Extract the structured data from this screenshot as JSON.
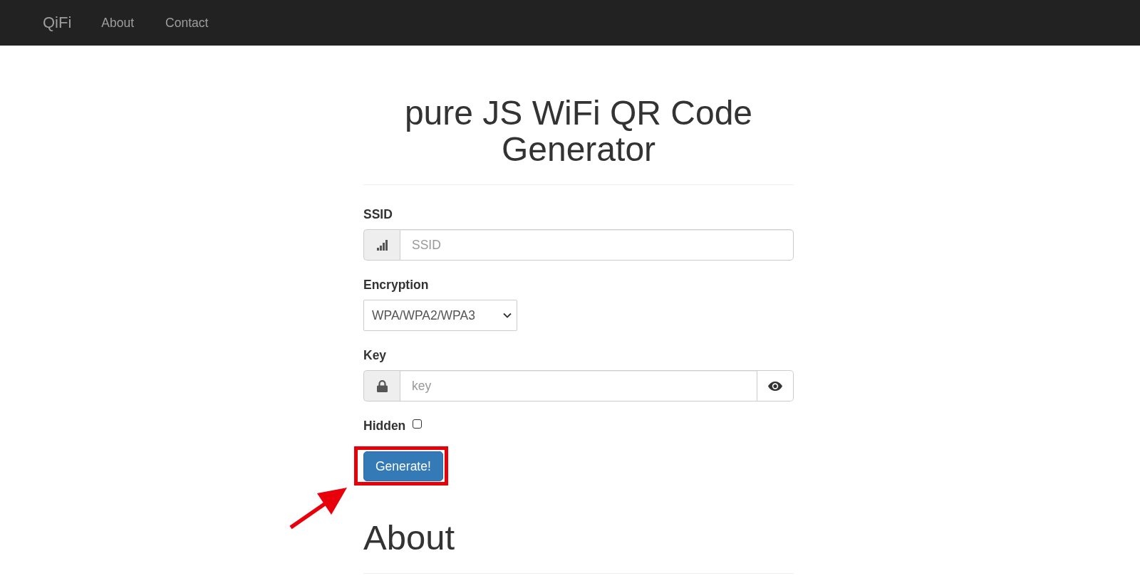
{
  "navbar": {
    "brand": "QiFi",
    "links": [
      {
        "label": "About"
      },
      {
        "label": "Contact"
      }
    ]
  },
  "page_title": "pure JS WiFi QR Code Generator",
  "form": {
    "fields": [
      {
        "kind": "text",
        "label": "SSID",
        "placeholder": "SSID"
      },
      {
        "kind": "select",
        "label": "Encryption",
        "value": "WPA/WPA2/WPA3"
      },
      {
        "kind": "password",
        "label": "Key",
        "placeholder": "key"
      },
      {
        "kind": "checkbox",
        "label": "Hidden",
        "checked": false
      }
    ],
    "submit": {
      "label": "Generate!",
      "highlighted": true
    }
  },
  "sections": [
    {
      "heading": "About"
    }
  ]
}
